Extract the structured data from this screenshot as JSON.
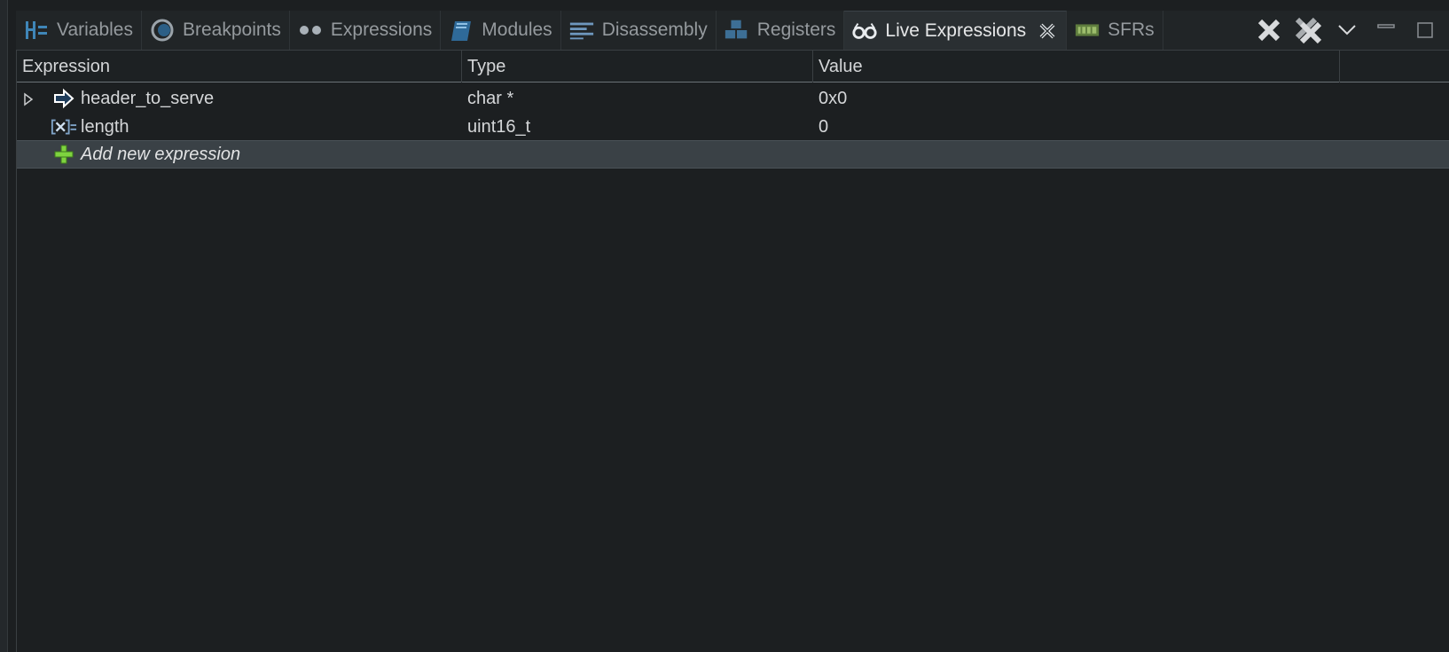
{
  "tabs": [
    {
      "label": "Variables",
      "icon": "variables-icon"
    },
    {
      "label": "Breakpoints",
      "icon": "breakpoints-icon"
    },
    {
      "label": "Expressions",
      "icon": "expressions-icon"
    },
    {
      "label": "Modules",
      "icon": "modules-icon"
    },
    {
      "label": "Disassembly",
      "icon": "disassembly-icon"
    },
    {
      "label": "Registers",
      "icon": "registers-icon"
    },
    {
      "label": "Live Expressions",
      "icon": "live-expressions-icon",
      "active": true
    },
    {
      "label": "SFRs",
      "icon": "sfrs-icon"
    }
  ],
  "toolbar": {
    "icons": [
      "remove-selected-icon",
      "remove-all-icon",
      "view-menu-icon",
      "minimize-icon",
      "maximize-icon"
    ]
  },
  "table": {
    "columns": [
      "Expression",
      "Type",
      "Value"
    ],
    "rows": [
      {
        "expression": "header_to_serve",
        "type": "char *",
        "value": "0x0",
        "icon": "pointer-arrow-icon",
        "expandable": true
      },
      {
        "expression": "length",
        "type": "uint16_t",
        "value": "0",
        "icon": "variable-icon",
        "expandable": false
      }
    ],
    "add_label": "Add new expression"
  },
  "colors": {
    "background": "#1c1f21",
    "tab_active": "#2a2f32",
    "add_row": "#3a4146",
    "add_icon": "#7ed33f"
  }
}
